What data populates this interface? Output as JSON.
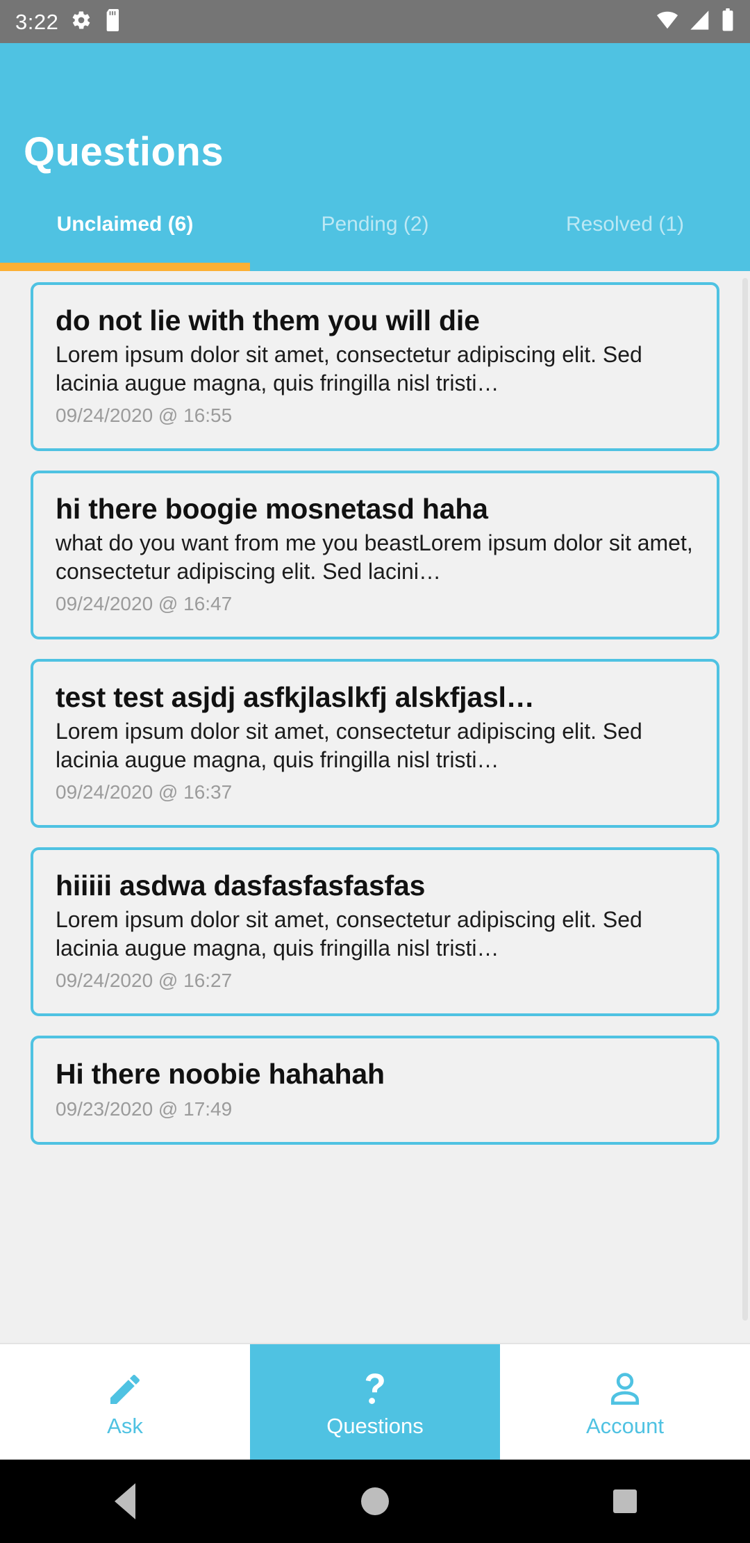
{
  "status_bar": {
    "time": "3:22",
    "left_icons": [
      "gear-icon",
      "sd-card-icon"
    ],
    "right_icons": [
      "wifi-icon",
      "cellular-signal-icon",
      "battery-icon"
    ]
  },
  "header": {
    "title": "Questions",
    "accent_color": "#4fc2e2",
    "indicator_color": "#fcb034"
  },
  "tabs": [
    {
      "label": "Unclaimed (6)",
      "active": true
    },
    {
      "label": "Pending (2)",
      "active": false
    },
    {
      "label": "Resolved (1)",
      "active": false
    }
  ],
  "questions": [
    {
      "title": "do not lie with them you will die",
      "body": "Lorem ipsum dolor sit amet, consectetur adipiscing elit. Sed lacinia augue magna, quis fringilla nisl tristi…",
      "timestamp": "09/24/2020 @ 16:55"
    },
    {
      "title": "hi there boogie mosnetasd haha",
      "body": "what do you want from me you beastLorem ipsum dolor sit amet, consectetur adipiscing elit. Sed lacini…",
      "timestamp": "09/24/2020 @ 16:47"
    },
    {
      "title": "test test asjdj asfkjlaslkfj alskfjasl…",
      "body": "Lorem ipsum dolor sit amet, consectetur adipiscing elit. Sed lacinia augue magna, quis fringilla nisl tristi…",
      "timestamp": "09/24/2020 @ 16:37"
    },
    {
      "title": "hiiiii asdwa dasfasfasfasfas",
      "body": "Lorem ipsum dolor sit amet, consectetur adipiscing elit. Sed lacinia augue magna, quis fringilla nisl tristi…",
      "timestamp": "09/24/2020 @ 16:27"
    },
    {
      "title": "Hi there noobie hahahah",
      "body": "",
      "timestamp": "09/23/2020 @ 17:49"
    }
  ],
  "bottom_nav": [
    {
      "label": "Ask",
      "icon": "pencil-icon",
      "active": false
    },
    {
      "label": "Questions",
      "icon": "question-mark-icon",
      "active": true
    },
    {
      "label": "Account",
      "icon": "person-icon",
      "active": false
    }
  ],
  "system_nav": {
    "back": "back-triangle-icon",
    "home": "home-circle-icon",
    "recents": "recents-square-icon"
  }
}
